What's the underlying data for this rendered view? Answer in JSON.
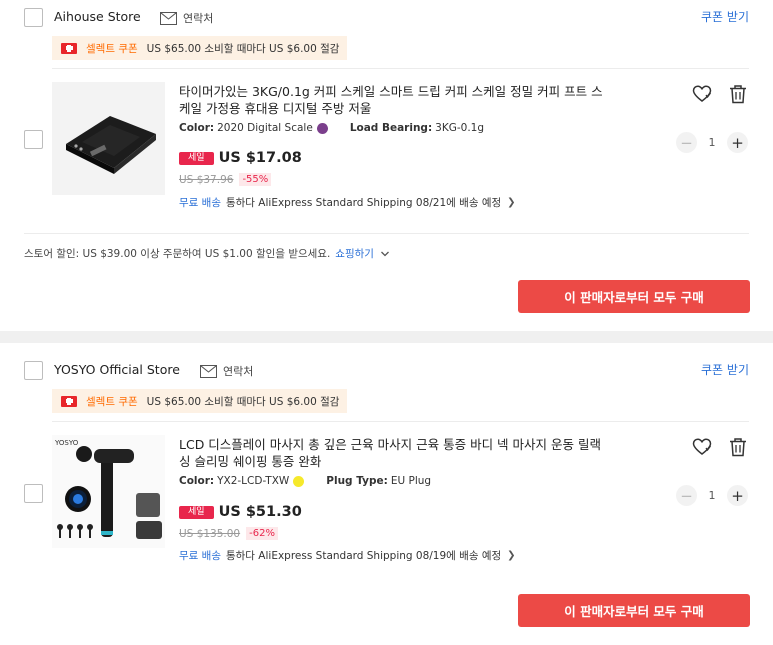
{
  "colors": {
    "accent_red": "#ec4a46",
    "link_blue": "#2a6fd6",
    "sale_pink": "#e8264c",
    "promo_bg": "#fdf1e4",
    "promo_orange": "#ff6a00"
  },
  "stores": [
    {
      "name": "Aihouse Store",
      "contact_label": "연락처",
      "coupon_label": "쿠폰 받기",
      "promo": {
        "tag": "셀렉트 쿠폰",
        "text": "US $65.00 소비할 때마다 US $6.00 절감"
      },
      "product": {
        "title": "타이머가있는 3KG/0.1g 커피 스케일 스마트 드립 커피 스케일 정밀 커피 프트 스케일 가정용 휴대용 디지털 주방 저울",
        "attr1_label": "Color:",
        "attr1_value": "2020 Digital Scale",
        "attr1_swatch": "#7b3f8c",
        "attr2_label": "Load Bearing:",
        "attr2_value": "3KG-0.1g",
        "sale_badge": "세일",
        "price": "US $17.08",
        "original_price": "US $37.96",
        "discount": "-55%",
        "free_shipping": "무료 배송",
        "shipping_text": "통하다 AliExpress Standard Shipping 08/21에 배송 예정",
        "quantity": "1",
        "icons": [
          "heart-icon",
          "trash-icon"
        ]
      },
      "store_discount": {
        "text": "스토어 할인: US $39.00 이상 주문하여 US $1.00 할인을 받으세요.",
        "link": "쇼핑하기"
      },
      "buy_all_label": "이 판매자로부터 모두 구매"
    },
    {
      "name": "YOSYO Official Store",
      "contact_label": "연락처",
      "coupon_label": "쿠폰 받기",
      "promo": {
        "tag": "셀렉트 쿠폰",
        "text": "US $65.00 소비할 때마다 US $6.00 절감"
      },
      "product": {
        "title": "LCD 디스플레이 마사지 총 깊은 근육 마사지 근육 통증 바디 넥 마사지 운동 릴랙싱 슬리밍 쉐이핑 통증 완화",
        "image_brand": "YOSYO",
        "attr1_label": "Color:",
        "attr1_value": "YX2-LCD-TXW",
        "attr1_swatch": "#f6e92b",
        "attr2_label": "Plug Type:",
        "attr2_value": "EU Plug",
        "sale_badge": "세일",
        "price": "US $51.30",
        "original_price": "US $135.00",
        "discount": "-62%",
        "free_shipping": "무료 배송",
        "shipping_text": "통하다 AliExpress Standard Shipping 08/19에 배송 예정",
        "quantity": "1",
        "icons": [
          "heart-icon",
          "trash-icon"
        ]
      },
      "buy_all_label": "이 판매자로부터 모두 구매"
    }
  ]
}
